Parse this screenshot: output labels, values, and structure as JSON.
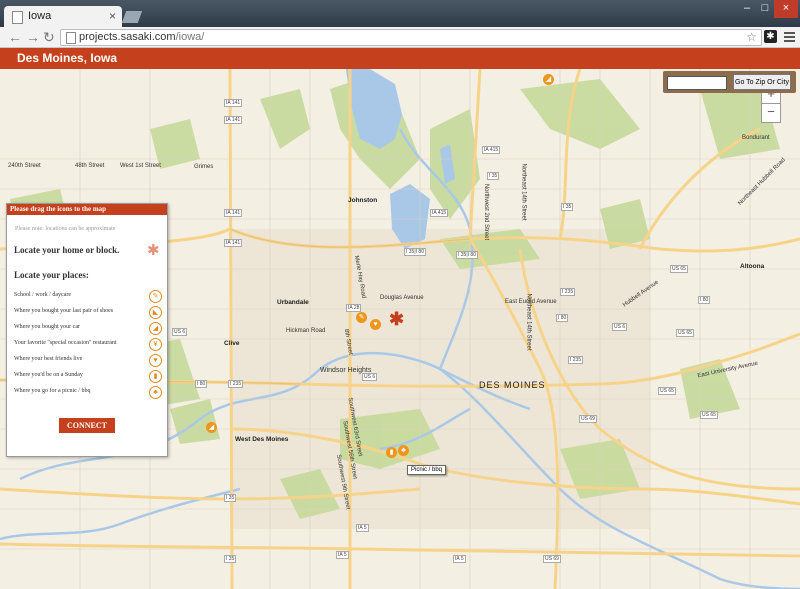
{
  "browser": {
    "tab_title": "Iowa",
    "url_host": "projects.sasaki.com",
    "url_path": "/iowa/",
    "back_icon": "back-arrow-icon",
    "forward_icon": "forward-arrow-icon",
    "reload_icon": "reload-icon"
  },
  "header": {
    "title": "Des Moines, Iowa",
    "color": "#c5401c"
  },
  "search": {
    "placeholder": "",
    "button_label": "Go To Zip Or City"
  },
  "panel": {
    "title": "Please drag the icons to the map",
    "note": "Please note: locations can be approximate",
    "home_label": "Locate your home or block.",
    "places_label": "Locate your places:",
    "places": [
      {
        "label": "School / work / daycare",
        "icon": "school-icon"
      },
      {
        "label": "Where you bought your last pair of shoes",
        "icon": "shoe-icon"
      },
      {
        "label": "Where you bought your car",
        "icon": "car-icon"
      },
      {
        "label": "Your favorite \"special occasion\" restaurant",
        "icon": "restaurant-icon"
      },
      {
        "label": "Where your best friends live",
        "icon": "heart-icon"
      },
      {
        "label": "Where you'd be on a Sunday",
        "icon": "sunday-icon"
      },
      {
        "label": "Where you go for a picnic / bbq",
        "icon": "picnic-icon"
      }
    ],
    "connect_label": "CONNECT"
  },
  "map": {
    "tooltip": "Picnic / bbq",
    "cities": {
      "johnston": "Johnston",
      "urbandale": "Urbandale",
      "clive": "Clive",
      "west_des_moines": "West Des Moines",
      "windsor": "Windsor Heights",
      "des_moines": "DES MOINES",
      "altoona": "Altoona",
      "grimes": "Grimes",
      "bondurant": "Bondurant"
    },
    "streets": {
      "s240": "240th Street",
      "s48": "48th Street",
      "w1": "West 1st Street",
      "douglas": "Douglas Avenue",
      "hickman": "Hickman Road",
      "euclid": "East Euclid Avenue",
      "hubbell": "Hubbell Avenue",
      "eu": "East University Avenue",
      "merle": "Merle Hay Road",
      "ne14": "Northeast 14th Street",
      "nw2": "Northwest 2nd Street",
      "n14": "Northeast 14th Street",
      "ne80": "Northeast Hubbell Road",
      "sw9": "Southwest 9th Street",
      "sw63": "Southwest 63rd Street",
      "sw56": "Southwest 56th Street",
      "s8": "8th Street"
    },
    "shields": {
      "i35a": "I 35",
      "i35b": "I 35",
      "i35c": "I 35",
      "i35d": "I 35",
      "i35e": "I 35",
      "i80a": "I 80",
      "i80b": "I 80",
      "i80c": "I 80",
      "i80d": "I 80",
      "i35e80a": "I 35|I 80",
      "i35e80b": "I 35|I 80",
      "i235a": "I 235",
      "i235b": "I 235",
      "i235c": "I 235",
      "i235d": "I 235",
      "ia141a": "IA 141",
      "ia141b": "IA 141",
      "ia141c": "IA 141",
      "ia141d": "IA 141",
      "ia141e": "IA 141",
      "ia415a": "IA 415",
      "ia415b": "IA 415",
      "ia5a": "IA 5",
      "ia5b": "IA 5",
      "ia5c": "IA 5",
      "ia28": "IA 28",
      "us6a": "US 6",
      "us6b": "US 6",
      "us6c": "US 6",
      "us6d": "US 6",
      "us65a": "US 65",
      "us65b": "US 65",
      "us65c": "US 65",
      "us65d": "US 65",
      "us65e": "US 65",
      "us69a": "US 69",
      "us69b": "US 69",
      "ia46": "IA 46",
      "ia163": "IA 163"
    }
  },
  "colors": {
    "accent": "#c5401c",
    "pin": "#f0961e",
    "water": "#a9c8e8",
    "park": "#c5d99a",
    "road": "#f7d38a"
  }
}
